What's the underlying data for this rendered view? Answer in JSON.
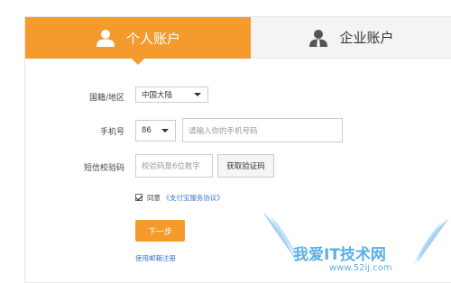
{
  "tabs": {
    "personal": "个人账户",
    "business": "企业账户"
  },
  "form": {
    "nationality_label": "国籍/地区",
    "nationality_value": "中国大陆",
    "phone_label": "手机号",
    "country_code": "86",
    "phone_placeholder": "请输入你的手机号码",
    "sms_label": "短信校验码",
    "sms_placeholder": "校验码是6位数字",
    "get_code_button": "获取验证码",
    "agree_text": "同意",
    "agree_link": "《支付宝服务协议》",
    "next_button": "下一步",
    "email_register_link": "使用邮箱注册"
  },
  "watermark": {
    "text": "我爱IT技术网",
    "url": "www.52ij.com"
  },
  "colors": {
    "accent": "#f59b2d",
    "link": "#3a76c8"
  }
}
